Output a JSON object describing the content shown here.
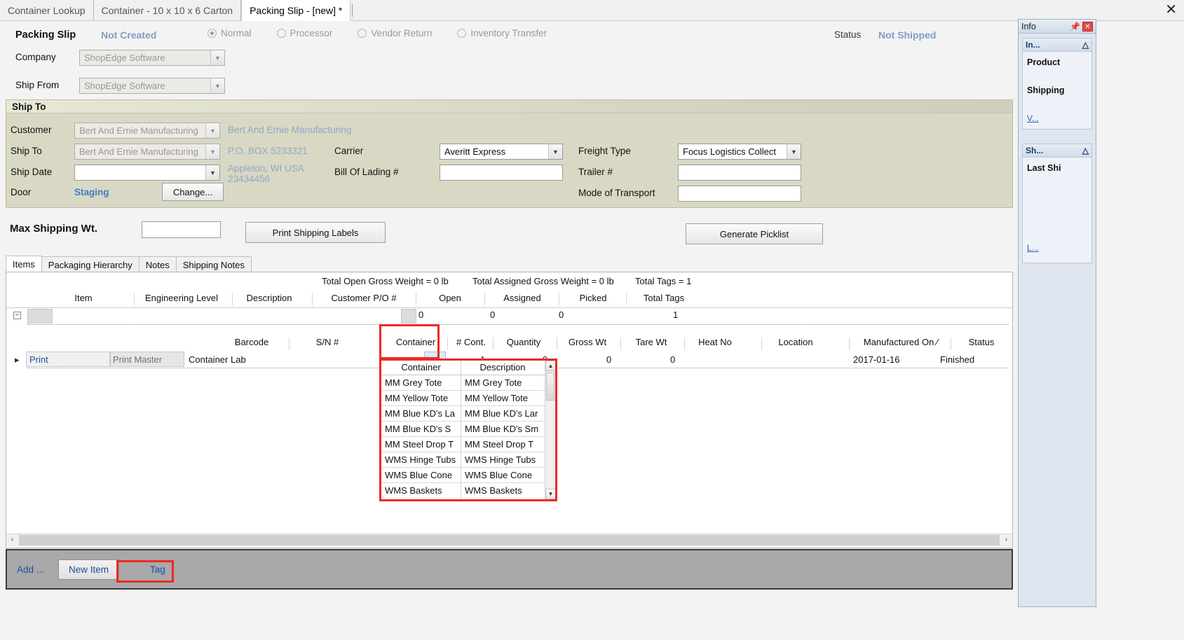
{
  "window": {
    "close_label": "✕",
    "tabs": [
      {
        "label": "Container Lookup",
        "active": false
      },
      {
        "label": "Container - 10 x 10 x 6 Carton",
        "active": false
      },
      {
        "label": "Packing Slip - [new] *",
        "active": true
      }
    ]
  },
  "header": {
    "packing_slip_label": "Packing Slip",
    "packing_slip_value": "Not Created",
    "status_label": "Status",
    "status_value": "Not Shipped",
    "types": [
      {
        "label": "Normal",
        "selected": true
      },
      {
        "label": "Processor",
        "selected": false
      },
      {
        "label": "Vendor Return",
        "selected": false
      },
      {
        "label": "Inventory Transfer",
        "selected": false
      }
    ]
  },
  "company": {
    "company_label": "Company",
    "company_value": "ShopEdge Software",
    "ship_from_label": "Ship From",
    "ship_from_value": "ShopEdge Software"
  },
  "ship_to": {
    "section_title": "Ship To",
    "customer_label": "Customer",
    "customer_value": "Bert And Ernie Manufacturing",
    "customer_display": "Bert And Ernie Manufacturing",
    "ship_to_label": "Ship To",
    "ship_to_value": "Bert And Ernie Manufacturing",
    "address_line1": "P.O. BOX 5233321",
    "address_line2": "Appleton, WI USA",
    "address_line3": "23434456",
    "ship_date_label": "Ship Date",
    "ship_date_value": "",
    "door_label": "Door",
    "door_value": "Staging",
    "change_button": "Change...",
    "carrier_label": "Carrier",
    "carrier_value": "Averitt Express",
    "bol_label": "Bill Of Lading #",
    "bol_value": "",
    "freight_type_label": "Freight Type",
    "freight_type_value": "Focus Logistics Collect",
    "trailer_label": "Trailer #",
    "trailer_value": "",
    "mode_label": "Mode of Transport",
    "mode_value": ""
  },
  "shipping": {
    "max_weight_label": "Max Shipping Wt.",
    "max_weight_value": "",
    "print_labels_button": "Print Shipping Labels",
    "generate_picklist_button": "Generate Picklist"
  },
  "subtabs": [
    {
      "label": "Items",
      "active": true
    },
    {
      "label": "Packaging Hierarchy",
      "active": false
    },
    {
      "label": "Notes",
      "active": false
    },
    {
      "label": "Shipping Notes",
      "active": false
    }
  ],
  "grid": {
    "totals": [
      "Total Open Gross Weight = 0 lb",
      "Total Assigned Gross Weight = 0 lb",
      "Total Tags = 1"
    ],
    "outer_columns": [
      "Item",
      "Engineering Level",
      "Description",
      "Customer P/O #",
      "Open",
      "Assigned",
      "Picked",
      "Total Tags"
    ],
    "outer_row": {
      "item": "",
      "engineering_level": "",
      "description": "",
      "customer_po": "0",
      "open": "0",
      "assigned": "0",
      "picked": "",
      "total_tags": "1"
    },
    "inner_columns": [
      "Barcode",
      "S/N #",
      "Container",
      "# Cont.",
      "Quantity",
      "Gross Wt",
      "Tare Wt",
      "Heat No",
      "Location",
      "Manufactured On",
      "Status"
    ],
    "inner_row": {
      "item": "Print",
      "engineering_level": "Print Master",
      "barcode": "Container Lab",
      "sn": "",
      "container": "",
      "num_cont": "1",
      "quantity": "0",
      "gross_wt": "0",
      "tare_wt": "0",
      "heat_no": "",
      "location": "",
      "manufactured_on": "2017-01-16",
      "status": "Finished"
    },
    "sort_indicator": "⁄"
  },
  "dropdown": {
    "headers": [
      "Container",
      "Description"
    ],
    "rows": [
      {
        "container": "MM Grey Tote",
        "description": "MM Grey Tote"
      },
      {
        "container": "MM Yellow Tote",
        "description": "MM Yellow Tote"
      },
      {
        "container": "MM Blue KD's La",
        "description": "MM Blue KD's Lar"
      },
      {
        "container": "MM Blue KD's S",
        "description": "MM Blue KD's Sm"
      },
      {
        "container": "MM Steel Drop T",
        "description": "MM Steel Drop T"
      },
      {
        "container": "WMS Hinge Tubs",
        "description": "WMS Hinge Tubs"
      },
      {
        "container": "WMS Blue Cone",
        "description": "WMS Blue Cone"
      },
      {
        "container": "WMS Baskets",
        "description": "WMS Baskets"
      }
    ]
  },
  "bottom_bar": {
    "add_label": "Add ...",
    "new_item_label": "New Item",
    "tag_label": "Tag"
  },
  "info_panel": {
    "title": "Info",
    "close_label": "✕",
    "groups": [
      {
        "title": "In...",
        "collapse_glyph": "»",
        "items": [
          "Product",
          "Shipping"
        ],
        "more": "V..."
      },
      {
        "title": "Sh...",
        "collapse_glyph": "»",
        "items": [
          "Last Shi"
        ],
        "more": "L..."
      }
    ]
  },
  "scroll": {
    "left_arrow": "‹",
    "right_arrow": "›",
    "up_arrow": "▲",
    "down_arrow": "▼"
  },
  "colors": {
    "accent_blue": "#3b7fc4",
    "highlight_red": "#ee2a24",
    "panel_olive": "#d9d8c4",
    "toolbar_gray": "#a9a9a9"
  }
}
